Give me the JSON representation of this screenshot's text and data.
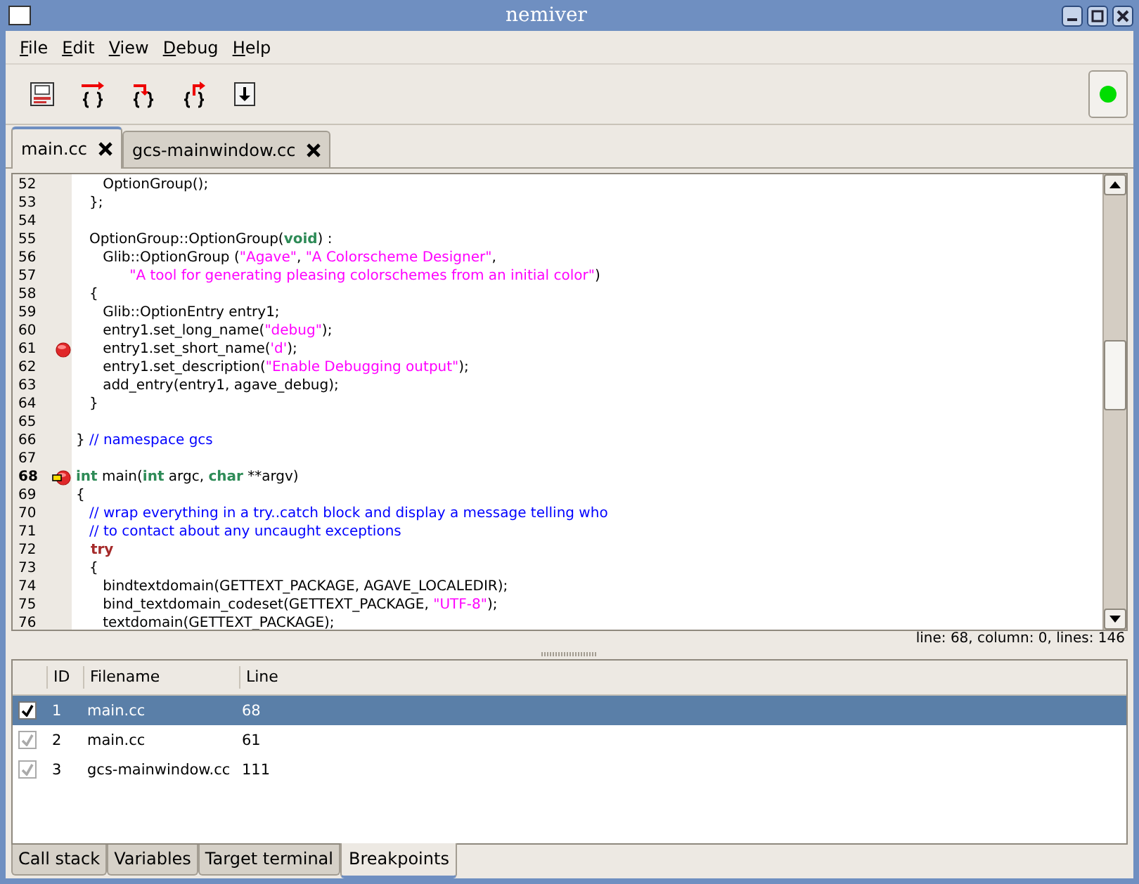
{
  "window": {
    "title": "nemiver"
  },
  "menu": [
    "File",
    "Edit",
    "View",
    "Debug",
    "Help"
  ],
  "toolbar": {
    "buttons": [
      {
        "kind": "document"
      },
      {
        "kind": "step-over"
      },
      {
        "kind": "step-in"
      },
      {
        "kind": "step-out"
      },
      {
        "kind": "continue"
      }
    ],
    "status_light": {
      "color": "#00dd00"
    }
  },
  "doc_tabs": [
    {
      "label": "main.cc",
      "selected": true
    },
    {
      "label": "gcs-mainwindow.cc",
      "selected": false
    }
  ],
  "code": {
    "lines": [
      {
        "number": "52",
        "breakpoint": false,
        "current": false,
        "tokens": [
          {
            "kind": "text",
            "text": "      OptionGroup();"
          }
        ]
      },
      {
        "number": "53",
        "breakpoint": false,
        "current": false,
        "tokens": [
          {
            "kind": "text",
            "text": "   };"
          }
        ]
      },
      {
        "number": "54",
        "breakpoint": false,
        "current": false
      },
      {
        "number": "55",
        "breakpoint": false,
        "current": false,
        "tokens": [
          {
            "kind": "text",
            "text": "   OptionGroup::OptionGroup("
          },
          {
            "kind": "keyword",
            "text": "void"
          },
          {
            "kind": "text",
            "text": ") :"
          }
        ]
      },
      {
        "number": "56",
        "breakpoint": false,
        "current": false,
        "tokens": [
          {
            "kind": "text",
            "text": "      Glib::OptionGroup ("
          },
          {
            "kind": "string",
            "text": "\"Agave\""
          },
          {
            "kind": "text",
            "text": ", "
          },
          {
            "kind": "string",
            "text": "\"A Colorscheme Designer\""
          },
          {
            "kind": "text",
            "text": ","
          }
        ]
      },
      {
        "number": "57",
        "breakpoint": false,
        "current": false,
        "tokens": [
          {
            "kind": "string",
            "text": "            \"A tool for generating pleasing colorschemes from an initial color\""
          },
          {
            "kind": "text",
            "text": ")"
          }
        ]
      },
      {
        "number": "58",
        "breakpoint": false,
        "current": false,
        "tokens": [
          {
            "kind": "text",
            "text": "   {"
          }
        ]
      },
      {
        "number": "59",
        "breakpoint": false,
        "current": false,
        "tokens": [
          {
            "kind": "text",
            "text": "      Glib::OptionEntry entry1;"
          }
        ]
      },
      {
        "number": "60",
        "breakpoint": false,
        "current": false,
        "tokens": [
          {
            "kind": "text",
            "text": "      entry1.set_long_name("
          },
          {
            "kind": "string",
            "text": "\"debug\""
          },
          {
            "kind": "text",
            "text": ");"
          }
        ]
      },
      {
        "number": "61",
        "breakpoint": true,
        "current": false,
        "tokens": [
          {
            "kind": "text",
            "text": "      entry1.set_short_name("
          },
          {
            "kind": "string",
            "text": "'d'"
          },
          {
            "kind": "text",
            "text": ");"
          }
        ]
      },
      {
        "number": "62",
        "breakpoint": false,
        "current": false,
        "tokens": [
          {
            "kind": "text",
            "text": "      entry1.set_description("
          },
          {
            "kind": "string",
            "text": "\"Enable Debugging output\""
          },
          {
            "kind": "text",
            "text": ");"
          }
        ]
      },
      {
        "number": "63",
        "breakpoint": false,
        "current": false,
        "tokens": [
          {
            "kind": "text",
            "text": "      add_entry(entry1, agave_debug);"
          }
        ]
      },
      {
        "number": "64",
        "breakpoint": false,
        "current": false,
        "tokens": [
          {
            "kind": "text",
            "text": "   }"
          }
        ]
      },
      {
        "number": "65",
        "breakpoint": false,
        "current": false
      },
      {
        "number": "66",
        "breakpoint": false,
        "current": false,
        "tokens": [
          {
            "kind": "text",
            "text": "} "
          },
          {
            "kind": "comment",
            "text": "// namespace gcs"
          }
        ]
      },
      {
        "number": "67",
        "breakpoint": false,
        "current": false
      },
      {
        "number": "68",
        "breakpoint": true,
        "current": true,
        "tokens": [
          {
            "kind": "keyword",
            "text": "int"
          },
          {
            "kind": "text",
            "text": " main("
          },
          {
            "kind": "keyword",
            "text": "int"
          },
          {
            "kind": "text",
            "text": " argc, "
          },
          {
            "kind": "keyword",
            "text": "char"
          },
          {
            "kind": "text",
            "text": " **argv)"
          }
        ]
      },
      {
        "number": "69",
        "breakpoint": false,
        "current": false,
        "tokens": [
          {
            "kind": "text",
            "text": "{"
          }
        ]
      },
      {
        "number": "70",
        "breakpoint": false,
        "current": false,
        "tokens": [
          {
            "kind": "comment",
            "text": "   // wrap everything in a try..catch block and display a message telling who"
          }
        ]
      },
      {
        "number": "71",
        "breakpoint": false,
        "current": false,
        "tokens": [
          {
            "kind": "comment",
            "text": "   // to contact about any uncaught exceptions"
          }
        ]
      },
      {
        "number": "72",
        "breakpoint": false,
        "current": false,
        "tokens": [
          {
            "kind": "control",
            "text": "   try"
          }
        ]
      },
      {
        "number": "73",
        "breakpoint": false,
        "current": false,
        "tokens": [
          {
            "kind": "text",
            "text": "   {"
          }
        ]
      },
      {
        "number": "74",
        "breakpoint": false,
        "current": false,
        "tokens": [
          {
            "kind": "text",
            "text": "      bindtextdomain(GETTEXT_PACKAGE, AGAVE_LOCALEDIR);"
          }
        ]
      },
      {
        "number": "75",
        "breakpoint": false,
        "current": false,
        "tokens": [
          {
            "kind": "text",
            "text": "      bind_textdomain_codeset(GETTEXT_PACKAGE, "
          },
          {
            "kind": "string",
            "text": "\"UTF-8\""
          },
          {
            "kind": "text",
            "text": ");"
          }
        ]
      },
      {
        "number": "76",
        "breakpoint": false,
        "current": false,
        "tokens": [
          {
            "kind": "text",
            "text": "      textdomain(GETTEXT_PACKAGE);"
          }
        ]
      }
    ],
    "status": "line: 68, column: 0, lines: 146"
  },
  "breakpoints": {
    "columns": [
      "ID",
      "Filename",
      "Line"
    ],
    "rows": [
      {
        "checked": true,
        "selected": true,
        "id": "1",
        "filename": "main.cc",
        "line": "68"
      },
      {
        "checked": true,
        "selected": false,
        "id": "2",
        "filename": "main.cc",
        "line": "61"
      },
      {
        "checked": true,
        "selected": false,
        "id": "3",
        "filename": "gcs-mainwindow.cc",
        "line": "111"
      }
    ]
  },
  "bottom_tabs": [
    {
      "label": "Call stack",
      "selected": false
    },
    {
      "label": "Variables",
      "selected": false
    },
    {
      "label": "Target terminal",
      "selected": false
    },
    {
      "label": "Breakpoints",
      "selected": true
    }
  ]
}
